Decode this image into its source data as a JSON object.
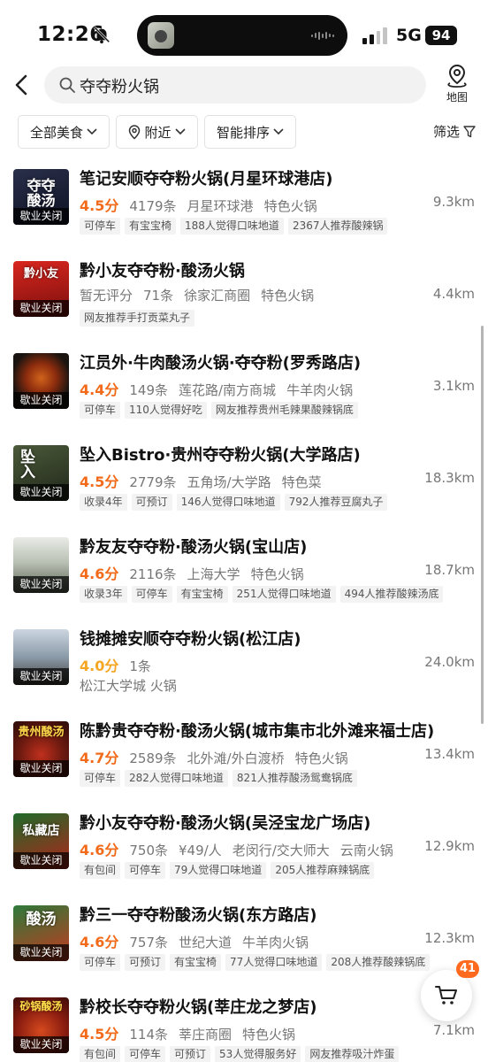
{
  "status_bar": {
    "time": "12:26",
    "network": "5G",
    "battery": "94"
  },
  "header": {
    "search_query": "夺夺粉火锅",
    "map_label": "地图"
  },
  "filters": {
    "category": "全部美食",
    "nearby": "附近",
    "sort": "智能排序",
    "filter_label": "筛选"
  },
  "icons": {
    "back": "chevron-left-icon",
    "search": "search-icon",
    "map": "map-pin-icon",
    "nearby": "location-pin-icon",
    "filter": "funnel-icon",
    "cart": "cart-icon",
    "status_bell": "bell-off-icon"
  },
  "colors": {
    "rating_orange": "#f26b1a",
    "rating_yellow": "#f5a623",
    "badge": "#ff6a1f"
  },
  "restaurants": [
    {
      "name": "笔记安顺夺夺粉火锅(月星环球港店)",
      "thumb_text": "夺夺\n酸汤",
      "closed_label": "歇业关闭",
      "rating": "4.5分",
      "reviews": "4179条",
      "area": "月星环球港",
      "cuisine": "特色火锅",
      "distance": "9.3km",
      "tags": [
        "可停车",
        "有宝宝椅",
        "188人觉得口味地道",
        "2367人推荐酸辣锅"
      ]
    },
    {
      "name": "黔小友夺夺粉·酸汤火锅",
      "thumb_text": "黔小友",
      "closed_label": "歇业关闭",
      "rating": "暂无评分",
      "reviews": "71条",
      "area": "徐家汇商圈",
      "cuisine": "特色火锅",
      "distance": "4.4km",
      "tags": [
        "网友推荐手打贡菜丸子"
      ]
    },
    {
      "name": "江员外·牛肉酸汤火锅·夺夺粉(罗秀路店)",
      "thumb_text": "",
      "closed_label": "歇业关闭",
      "rating": "4.4分",
      "reviews": "149条",
      "area": "莲花路/南方商城",
      "cuisine": "牛羊肉火锅",
      "distance": "3.1km",
      "tags": [
        "可停车",
        "110人觉得好吃",
        "网友推荐贵州毛辣果酸辣锅底"
      ]
    },
    {
      "name": "坠入Bistro·贵州夺夺粉火锅(大学路店)",
      "thumb_text": "坠\n入",
      "closed_label": "歇业关闭",
      "rating": "4.5分",
      "reviews": "2779条",
      "area": "五角场/大学路",
      "cuisine": "特色菜",
      "distance": "18.3km",
      "tags": [
        "收录4年",
        "可预订",
        "146人觉得口味地道",
        "792人推荐豆腐丸子"
      ]
    },
    {
      "name": "黔友友夺夺粉·酸汤火锅(宝山店)",
      "thumb_text": "",
      "closed_label": "歇业关闭",
      "rating": "4.6分",
      "reviews": "2116条",
      "area": "上海大学",
      "cuisine": "特色火锅",
      "distance": "18.7km",
      "tags": [
        "收录3年",
        "可停车",
        "有宝宝椅",
        "251人觉得口味地道",
        "494人推荐酸辣汤底"
      ]
    },
    {
      "name": "钱摊摊安顺夺夺粉火锅(松江店)",
      "thumb_text": "",
      "closed_label": "歇业关闭",
      "rating": "4.0分",
      "reviews": "1条",
      "area": "",
      "cuisine": "",
      "distance": "24.0km",
      "sub_line": "松江大学城 火锅",
      "tags": []
    },
    {
      "name": "陈黔贵夺夺粉·酸汤火锅(城市集市北外滩来福士店)",
      "thumb_text": "贵州酸汤",
      "closed_label": "歇业关闭",
      "rating": "4.7分",
      "reviews": "2589条",
      "area": "北外滩/外白渡桥",
      "cuisine": "特色火锅",
      "distance": "13.4km",
      "tags": [
        "可停车",
        "282人觉得口味地道",
        "821人推荐酸汤鸳鸯锅底"
      ]
    },
    {
      "name": "黔小友夺夺粉·酸汤火锅(吴泾宝龙广场店)",
      "thumb_text": "私藏店",
      "closed_label": "歇业关闭",
      "rating": "4.6分",
      "reviews": "750条",
      "price": "¥49/人",
      "area": "老闵行/交大师大",
      "cuisine": "云南火锅",
      "distance": "12.9km",
      "tags": [
        "有包间",
        "可停车",
        "79人觉得口味地道",
        "205人推荐麻辣锅底"
      ]
    },
    {
      "name": "黔三一夺夺粉酸汤火锅(东方路店)",
      "thumb_text": "酸汤",
      "closed_label": "歇业关闭",
      "rating": "4.6分",
      "reviews": "757条",
      "area": "世纪大道",
      "cuisine": "牛羊肉火锅",
      "distance": "12.3km",
      "tags": [
        "可停车",
        "可预订",
        "有宝宝椅",
        "77人觉得口味地道",
        "208人推荐酸辣锅底"
      ]
    },
    {
      "name": "黔校长夺夺粉火锅(莘庄龙之梦店)",
      "thumb_text": "砂锅酸汤",
      "closed_label": "歇业关闭",
      "rating": "4.5分",
      "reviews": "114条",
      "area": "莘庄商圈",
      "cuisine": "特色火锅",
      "distance": "7.1km",
      "tags": [
        "有包间",
        "可停车",
        "可预订",
        "53人觉得服务好",
        "网友推荐吸汁炸蛋"
      ]
    }
  ],
  "cart": {
    "count": "41"
  }
}
